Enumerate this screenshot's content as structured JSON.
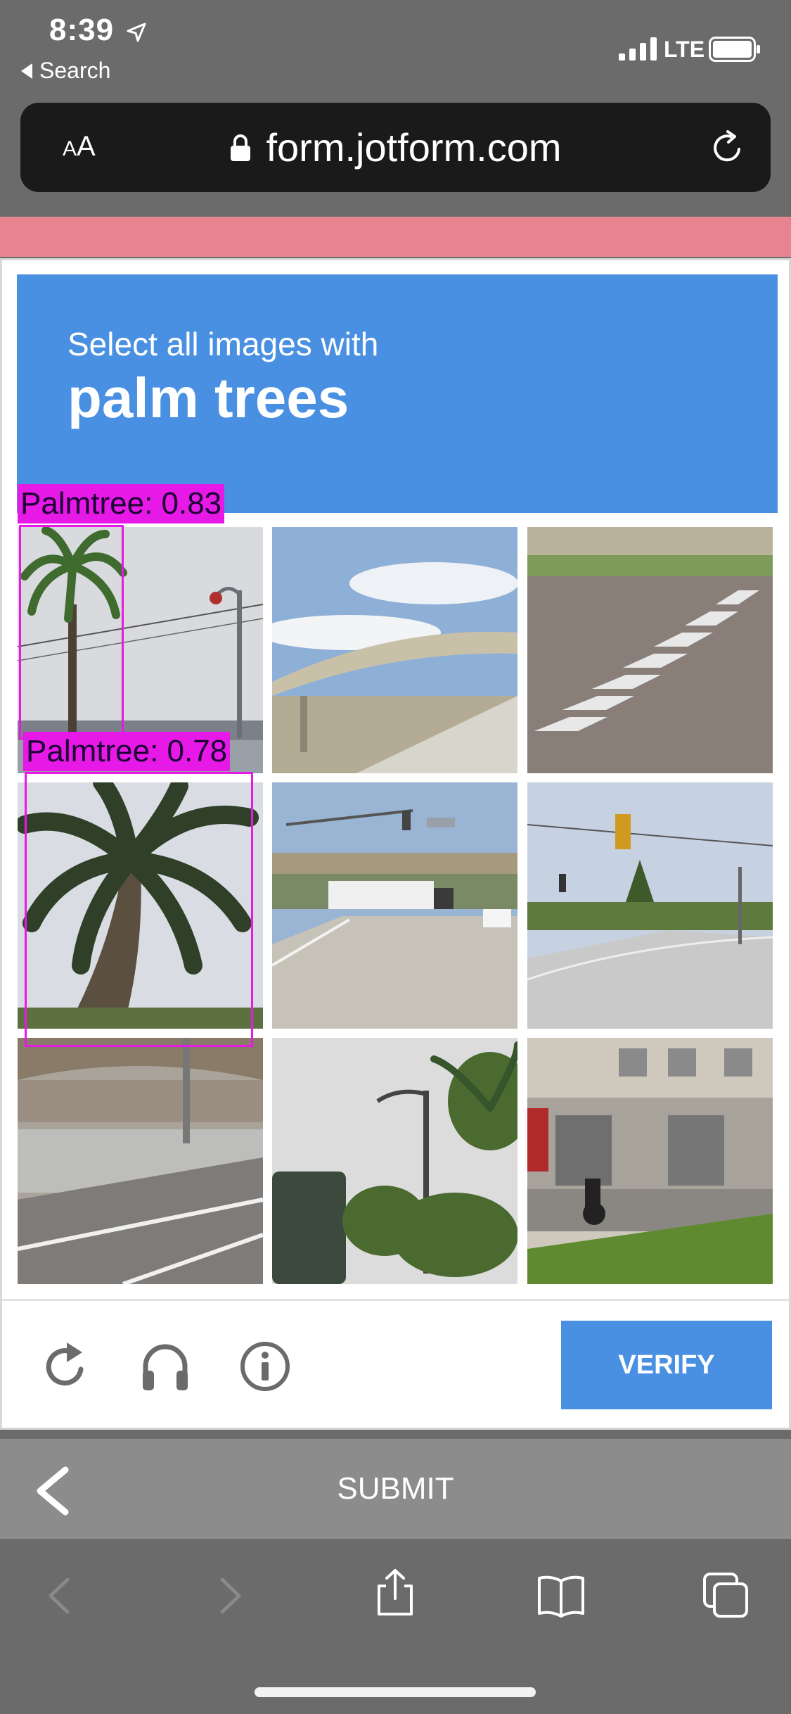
{
  "status_bar": {
    "time": "8:39",
    "back_label": "Search",
    "network": "LTE"
  },
  "browser": {
    "text_size_small": "A",
    "text_size_large": "A",
    "url": "form.jotform.com"
  },
  "captcha": {
    "prompt_line": "Select all images with",
    "prompt_object": "palm trees",
    "tiles": [
      "street-light-palm",
      "overpass-sky",
      "crosswalk",
      "palm-tree-closeup",
      "truck-under-overpass",
      "intersection-traffic-light",
      "freeway-overpass",
      "palm-and-lamppost",
      "storefront-motorbike"
    ],
    "detections": [
      {
        "label": "Palmtree: 0.83"
      },
      {
        "label": "Palmtree: 0.78"
      }
    ],
    "verify_label": "VERIFY",
    "detection_color": "#e619e6",
    "accent_color": "#4a90e2"
  },
  "form": {
    "submit_label": "SUBMIT",
    "band_color": "#e8848f"
  }
}
